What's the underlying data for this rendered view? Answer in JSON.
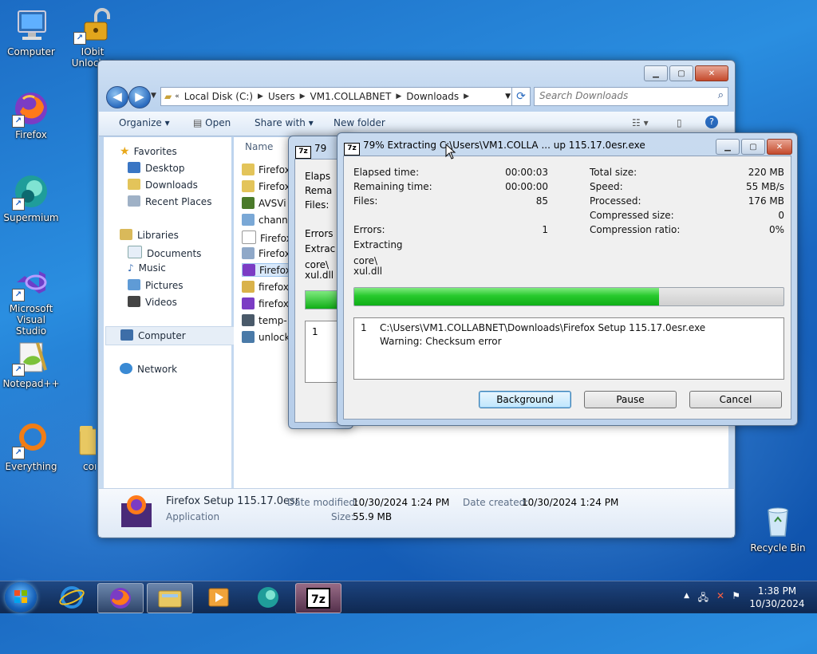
{
  "desktop": {
    "icons": [
      {
        "label": "Computer"
      },
      {
        "label": "IObit Unlocker"
      },
      {
        "label": "Firefox"
      },
      {
        "label": "Supermium"
      },
      {
        "label": "Microsoft Visual Studio"
      },
      {
        "label": "Notepad++"
      },
      {
        "label": "Everything"
      },
      {
        "label": "cor"
      },
      {
        "label": "Recycle Bin"
      }
    ]
  },
  "explorer": {
    "address": [
      "Local Disk (C:)",
      "Users",
      "VM1.COLLABNET",
      "Downloads"
    ],
    "search_placeholder": "Search Downloads",
    "commands": {
      "organize": "Organize",
      "open": "Open",
      "share": "Share with",
      "newfolder": "New folder"
    },
    "nav": {
      "favorites": "Favorites",
      "desktop": "Desktop",
      "downloads": "Downloads",
      "recent": "Recent Places",
      "libraries": "Libraries",
      "documents": "Documents",
      "music": "Music",
      "pictures": "Pictures",
      "videos": "Videos",
      "computer": "Computer",
      "network": "Network"
    },
    "column_name": "Name",
    "files": [
      "Firefox",
      "Firefox",
      "AVSVi",
      "chann",
      "Firefox",
      "Firefox",
      "Firefox",
      "firefox",
      "firefox",
      "temp-",
      "unlock"
    ],
    "details": {
      "name": "Firefox Setup 115.17.0esr",
      "type": "Application",
      "modified_label": "Date modified:",
      "modified": "10/30/2024 1:24 PM",
      "created_label": "Date created:",
      "created": "10/30/2024 1:24 PM",
      "size_label": "Size:",
      "size": "55.9 MB"
    }
  },
  "sevenzip_back": {
    "title": "79",
    "labels": [
      "Elaps",
      "Rema",
      "Files:",
      "Errors",
      "Extrac",
      "core\\",
      "xul.dll",
      "1"
    ]
  },
  "sevenzip": {
    "title": "79% Extracting C:\\Users\\VM1.COLLA ... up 115.17.0esr.exe",
    "stats_left": [
      {
        "label": "Elapsed time:",
        "value": "00:00:03"
      },
      {
        "label": "Remaining time:",
        "value": "00:00:00"
      },
      {
        "label": "Files:",
        "value": "85"
      },
      {
        "label": "Errors:",
        "value": "1"
      }
    ],
    "stats_right": [
      {
        "label": "Total size:",
        "value": "220 MB"
      },
      {
        "label": "Speed:",
        "value": "55 MB/s"
      },
      {
        "label": "Processed:",
        "value": "176 MB"
      },
      {
        "label": "Compressed size:",
        "value": "0"
      },
      {
        "label": "Compression ratio:",
        "value": "0%"
      }
    ],
    "action": "Extracting",
    "current_dir": "core\\",
    "current_file": "xul.dll",
    "progress": 0.71,
    "log": {
      "index": "1",
      "path": "C:\\Users\\VM1.COLLABNET\\Downloads\\Firefox Setup 115.17.0esr.exe",
      "message": "Warning: Checksum error"
    },
    "buttons": {
      "background": "Background",
      "pause": "Pause",
      "cancel": "Cancel"
    }
  },
  "taskbar": {
    "time": "1:38 PM",
    "date": "10/30/2024"
  }
}
